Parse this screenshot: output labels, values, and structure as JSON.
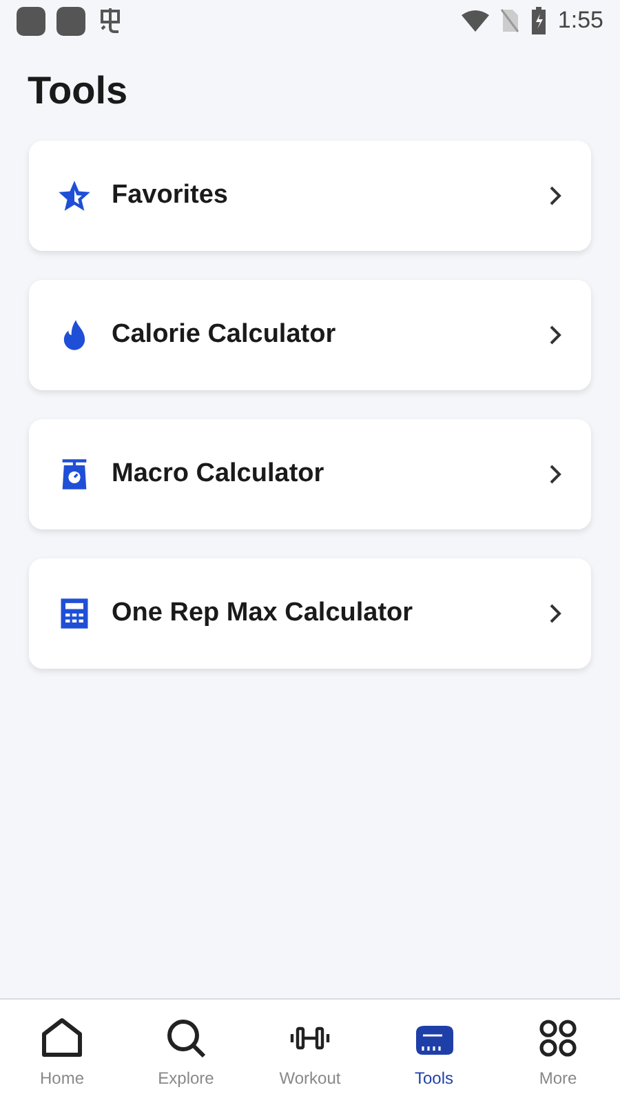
{
  "status_bar": {
    "time": "1:55"
  },
  "title": "Tools",
  "tools": [
    {
      "kind": "star",
      "label": "Favorites"
    },
    {
      "kind": "flame",
      "label": "Calorie Calculator"
    },
    {
      "kind": "scale",
      "label": "Macro Calculator"
    },
    {
      "kind": "calculator",
      "label": "One Rep Max Calculator"
    }
  ],
  "nav": [
    {
      "kind": "home",
      "label": "Home",
      "selected": false
    },
    {
      "kind": "search",
      "label": "Explore",
      "selected": false
    },
    {
      "kind": "dumbbell",
      "label": "Workout",
      "selected": false
    },
    {
      "kind": "tape",
      "label": "Tools",
      "selected": true
    },
    {
      "kind": "grid",
      "label": "More",
      "selected": false
    }
  ]
}
